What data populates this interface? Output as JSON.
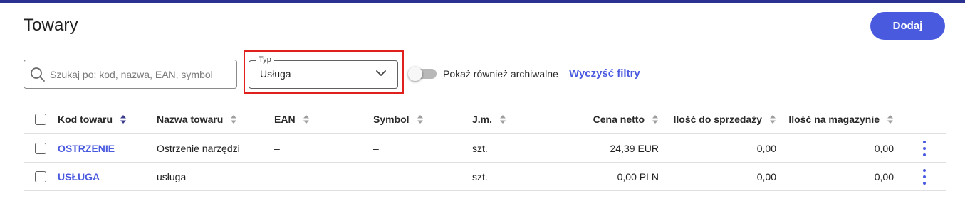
{
  "header": {
    "title": "Towary",
    "add_button": "Dodaj"
  },
  "filters": {
    "search_placeholder": "Szukaj po: kod, nazwa, EAN, symbol",
    "type_label": "Typ",
    "type_value": "Usługa",
    "archive_toggle_label": "Pokaż również archiwalne",
    "archive_toggle_on": false,
    "clear_filters": "Wyczyść filtry"
  },
  "table": {
    "columns": [
      "Kod towaru",
      "Nazwa towaru",
      "EAN",
      "Symbol",
      "J.m.",
      "Cena netto",
      "Ilość do sprzedaży",
      "Ilość na magazynie"
    ],
    "sorted_column": "Kod towaru",
    "rows": [
      {
        "code": "OSTRZENIE",
        "name": "Ostrzenie narzędzi",
        "ean": "–",
        "symbol": "–",
        "unit": "szt.",
        "price": "24,39 EUR",
        "qty_sale": "0,00",
        "qty_stock": "0,00"
      },
      {
        "code": "USŁUGA",
        "name": "usługa",
        "ean": "–",
        "symbol": "–",
        "unit": "szt.",
        "price": "0,00 PLN",
        "qty_sale": "0,00",
        "qty_stock": "0,00"
      }
    ]
  },
  "colors": {
    "accent": "#4a5adf",
    "top_strip": "#2b3190",
    "highlight": "#e0201c"
  }
}
